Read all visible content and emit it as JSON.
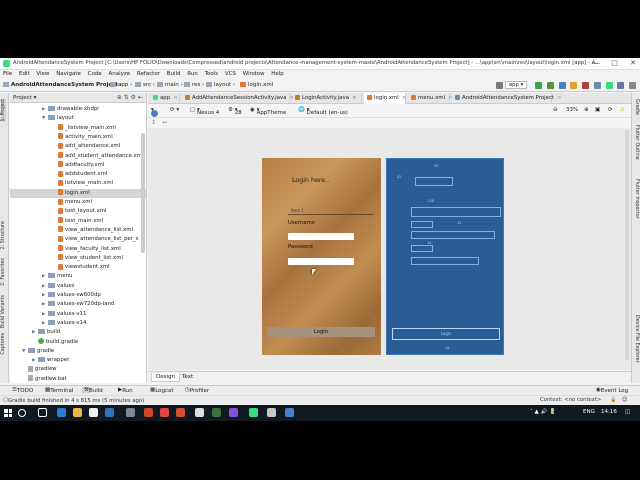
{
  "window": {
    "title": "AndroidAttendanceSystem Project [C:\\Users\\HP FOLIO\\Downloads\\Compressed\\android projects\\Attendance-management-system-maste\\AndroidAttendanceSystem Project] - ...\\app\\src\\main\\res\\layout\\login.xml [app] - A..."
  },
  "menu": [
    "File",
    "Edit",
    "View",
    "Navigate",
    "Code",
    "Analyze",
    "Refactor",
    "Build",
    "Run",
    "Tools",
    "VCS",
    "Window",
    "Help"
  ],
  "breadcrumb": [
    "AndroidAttendanceSystem Project",
    "app",
    "src",
    "main",
    "res",
    "layout",
    "login.xml"
  ],
  "run_config": "app",
  "project_panel": {
    "title": "Project",
    "tree": [
      {
        "label": "drawable-xhdpi",
        "type": "folder",
        "indent": 1
      },
      {
        "label": "layout",
        "type": "folder",
        "indent": 1,
        "open": true
      },
      {
        "label": "_listview_main.xml",
        "type": "xml",
        "indent": 2
      },
      {
        "label": "activity_main.xml",
        "type": "xml",
        "indent": 2
      },
      {
        "label": "add_attendance.xml",
        "type": "xml",
        "indent": 2
      },
      {
        "label": "add_student_attendance.xml",
        "type": "xml",
        "indent": 2
      },
      {
        "label": "addfaculty.xml",
        "type": "xml",
        "indent": 2
      },
      {
        "label": "addstudent.xml",
        "type": "xml",
        "indent": 2
      },
      {
        "label": "listview_main.xml",
        "type": "xml",
        "indent": 2
      },
      {
        "label": "login.xml",
        "type": "xml",
        "indent": 2,
        "selected": true
      },
      {
        "label": "menu.xml",
        "type": "xml",
        "indent": 2
      },
      {
        "label": "test_layout.xml",
        "type": "xml",
        "indent": 2
      },
      {
        "label": "test_main.xml",
        "type": "xml",
        "indent": 2
      },
      {
        "label": "view_attendance_list.xml",
        "type": "xml",
        "indent": 2
      },
      {
        "label": "view_attendance_list_per_s",
        "type": "xml",
        "indent": 2
      },
      {
        "label": "view_faculty_list.xml",
        "type": "xml",
        "indent": 2
      },
      {
        "label": "view_student_list.xml",
        "type": "xml",
        "indent": 2
      },
      {
        "label": "viewstudent.xml",
        "type": "xml",
        "indent": 2
      },
      {
        "label": "menu",
        "type": "folder",
        "indent": 1
      },
      {
        "label": "values",
        "type": "folder",
        "indent": 1
      },
      {
        "label": "values-sw600dp",
        "type": "folder",
        "indent": 1
      },
      {
        "label": "values-sw720dp-land",
        "type": "folder",
        "indent": 1
      },
      {
        "label": "values-v11",
        "type": "folder",
        "indent": 1
      },
      {
        "label": "values-v14",
        "type": "folder",
        "indent": 1
      },
      {
        "label": "build",
        "type": "folder",
        "indent": 0
      },
      {
        "label": "build.gradle",
        "type": "gradle",
        "indent": 0
      },
      {
        "label": "gradle",
        "type": "folder",
        "indent": -1,
        "open": true
      },
      {
        "label": "wrapper",
        "type": "folder",
        "indent": 0
      },
      {
        "label": "gradlew",
        "type": "file",
        "indent": -1
      },
      {
        "label": "gradlew.bat",
        "type": "file",
        "indent": -1
      }
    ]
  },
  "left_strip": [
    "1: Project",
    "2: Structure",
    "Captures",
    "Build Variants",
    "2: Favorites"
  ],
  "right_strip": [
    "Gradle",
    "Flutter Outline",
    "Flutter Inspector",
    "Device File Explorer"
  ],
  "tabs": [
    {
      "label": "app",
      "active": false
    },
    {
      "label": "AddAttendanceSessionActivity.java",
      "active": false
    },
    {
      "label": "LoginActivity.java",
      "active": false
    },
    {
      "label": "login.xml",
      "active": true
    },
    {
      "label": "menu.xml",
      "active": false
    },
    {
      "label": "AndroidAttendanceSystem Project",
      "active": false
    }
  ],
  "design_toolbar": {
    "device": "Nexus 4",
    "api": "28",
    "theme": "AppTheme",
    "locale": "Default (en-us)",
    "zoom": "33%"
  },
  "phone_preview": {
    "heading": "Login here..",
    "spinner_text": "Item 1",
    "username_label": "Username",
    "password_label": "Password",
    "login_button": "Login"
  },
  "blueprint": {
    "dims": [
      "43",
      "42",
      "118",
      "12",
      "14",
      "16"
    ],
    "button_label": "Login"
  },
  "bottom_tabs": [
    {
      "label": "Design",
      "active": true
    },
    {
      "label": "Text",
      "active": false
    }
  ],
  "tool_windows": [
    "TODO",
    "Terminal",
    "Build",
    "Run",
    "Logcat",
    "Profiler",
    "Event Log"
  ],
  "status": {
    "message": "Gradle build finished in 4 s 815 ms (5 minutes ago)",
    "context": "Context: <no context>"
  },
  "taskbar": {
    "lang": "ENG",
    "time": "14:16"
  },
  "colors": {
    "blueprint_bg": "#2a5c95",
    "accent_green": "#3ddc84",
    "xml_icon": "#e07a3a"
  }
}
